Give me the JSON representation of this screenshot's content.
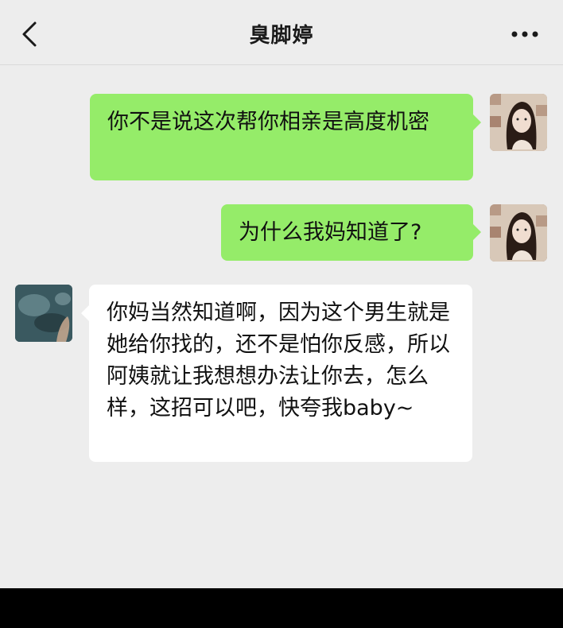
{
  "header": {
    "title": "臭脚婷"
  },
  "icons": {
    "back": "chevron-left-icon",
    "more": "more-dots-icon"
  },
  "messages": [
    {
      "sender": "me",
      "text": "你不是说这次帮你相亲是高度机密"
    },
    {
      "sender": "me",
      "text": "为什么我妈知道了?"
    },
    {
      "sender": "friend",
      "text": "你妈当然知道啊，因为这个男生就是她给你找的，还不是怕你反感，所以阿姨就让我想想办法让你去，怎么样，这招可以吧，快夸我baby~"
    }
  ],
  "colors": {
    "outgoing_bubble": "#95ec69",
    "incoming_bubble": "#ffffff",
    "background": "#ededed"
  }
}
